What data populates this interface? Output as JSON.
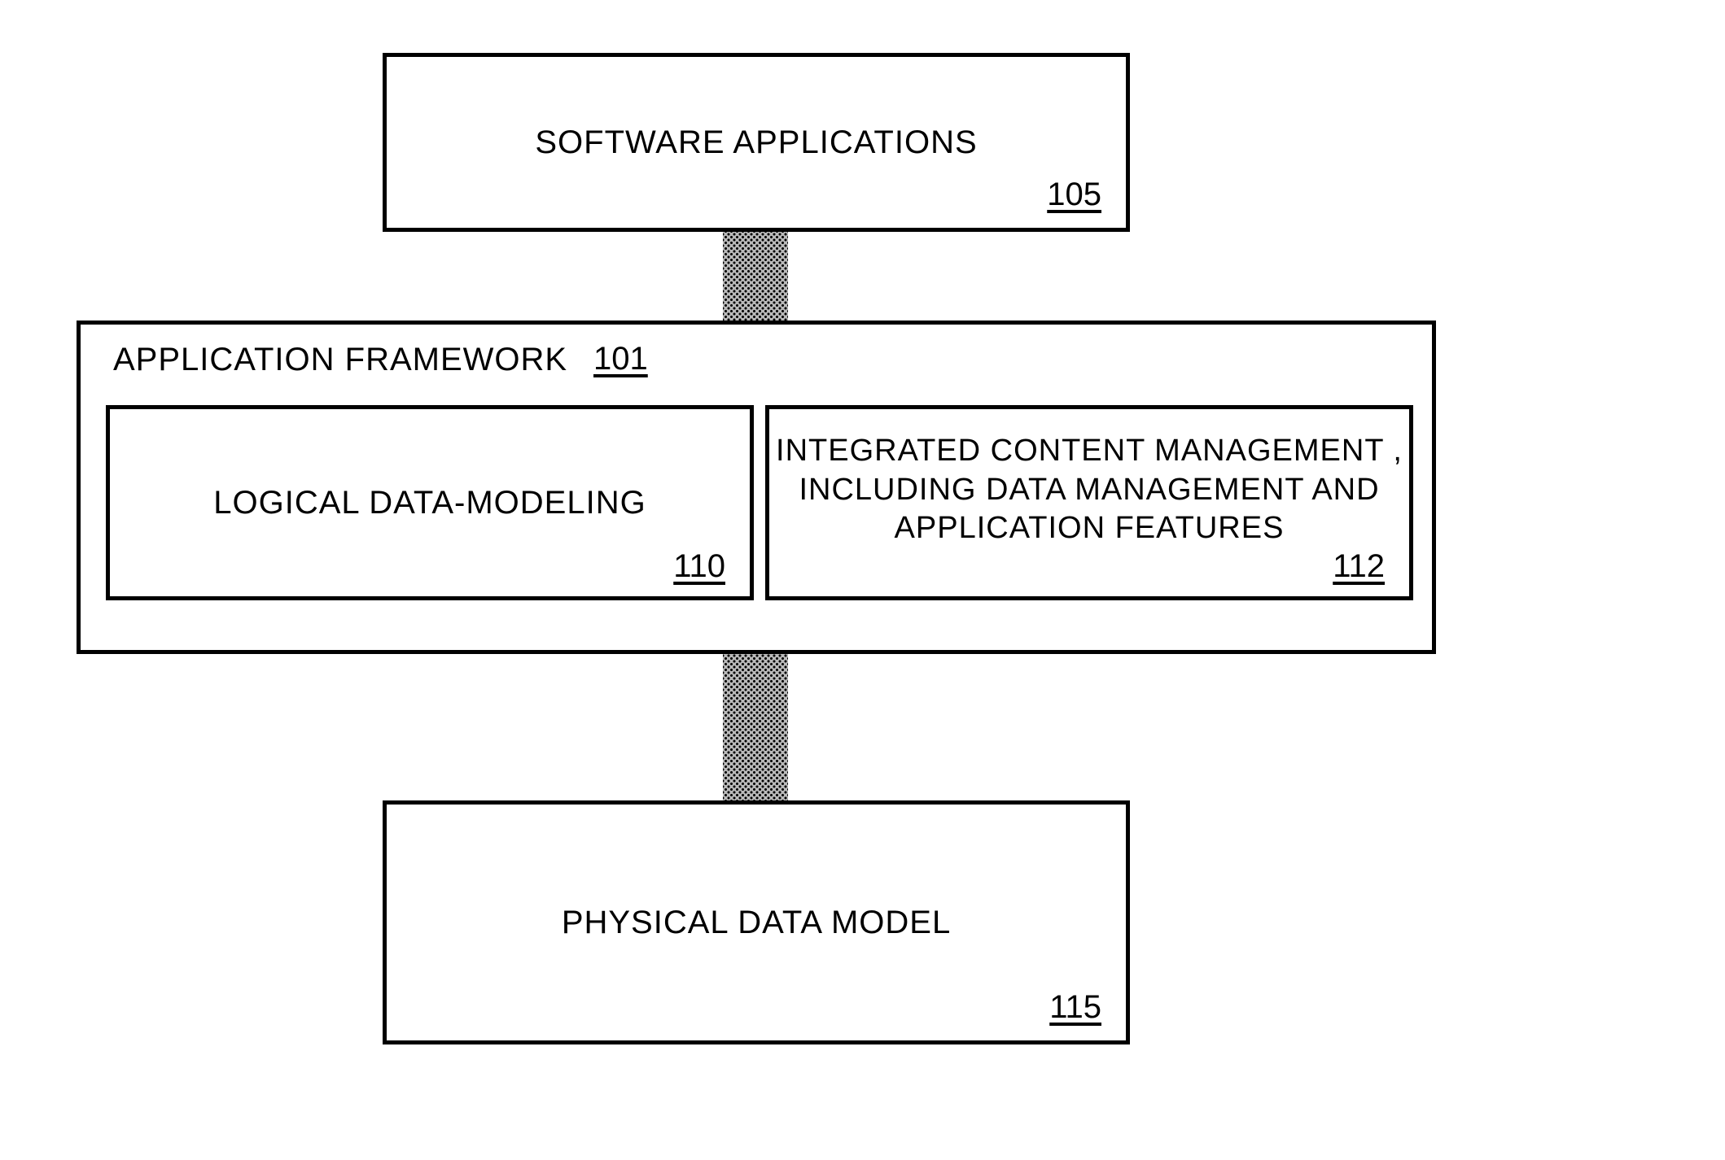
{
  "boxes": {
    "software_applications": {
      "label": "SOFTWARE APPLICATIONS",
      "ref": "105"
    },
    "application_framework": {
      "label": "APPLICATION FRAMEWORK",
      "ref": "101"
    },
    "logical_data_modeling": {
      "label": "LOGICAL DATA-MODELING",
      "ref": "110"
    },
    "integrated_content_mgmt": {
      "label": "INTEGRATED CONTENT MANAGEMENT ,\nINCLUDING DATA MANAGEMENT AND\nAPPLICATION FEATURES",
      "ref": "112"
    },
    "physical_data_model": {
      "label": "PHYSICAL DATA MODEL",
      "ref": "115"
    }
  }
}
